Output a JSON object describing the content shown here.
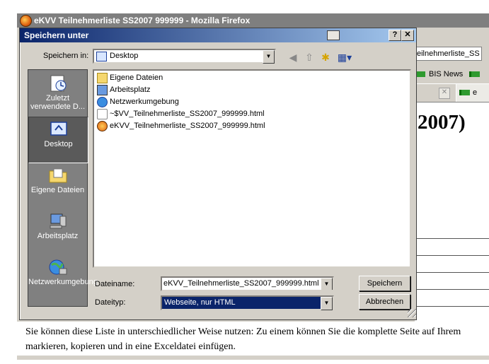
{
  "browser": {
    "title": "eKVV Teilnehmerliste SS2007 999999 - Mozilla Firefox",
    "url_fragment": "eilnehmerliste_SS",
    "bookmark": "BIS News",
    "tab_fragment": "e",
    "tab_close": "✕",
    "heading_fragment": "2007)",
    "bottom_text_line1": "Sie können diese Liste in unterschiedlicher Weise nutzen: Zu einem können Sie die komplette Seite auf Ihrem",
    "bottom_text_line2": "markieren, kopieren und in eine Exceldatei einfügen."
  },
  "dialog": {
    "title": "Speichern unter",
    "help_label": "?",
    "close_label": "✕",
    "save_in_label": "Speichern in:",
    "save_in_value": "Desktop",
    "places": [
      {
        "label": "Zuletzt verwendete D..."
      },
      {
        "label": "Desktop"
      },
      {
        "label": "Eigene Dateien"
      },
      {
        "label": "Arbeitsplatz"
      },
      {
        "label": "Netzwerkumgebung"
      }
    ],
    "files": [
      {
        "name": "Eigene Dateien"
      },
      {
        "name": "Arbeitsplatz"
      },
      {
        "name": "Netzwerkumgebung"
      },
      {
        "name": "~$VV_Teilnehmerliste_SS2007_999999.html"
      },
      {
        "name": "eKVV_Teilnehmerliste_SS2007_999999.html"
      }
    ],
    "filename_label": "Dateiname:",
    "filename_value": "eKVV_Teilnehmerliste_SS2007_999999.html",
    "filetype_label": "Dateityp:",
    "filetype_value": "Webseite, nur HTML",
    "save_button": "Speichern",
    "cancel_button": "Abbrechen"
  },
  "colors": {
    "dialog_title_start": "#0a246a",
    "dialog_title_end": "#a6caf0",
    "selection": "#0a246a",
    "window_face": "#d4d0c8"
  }
}
